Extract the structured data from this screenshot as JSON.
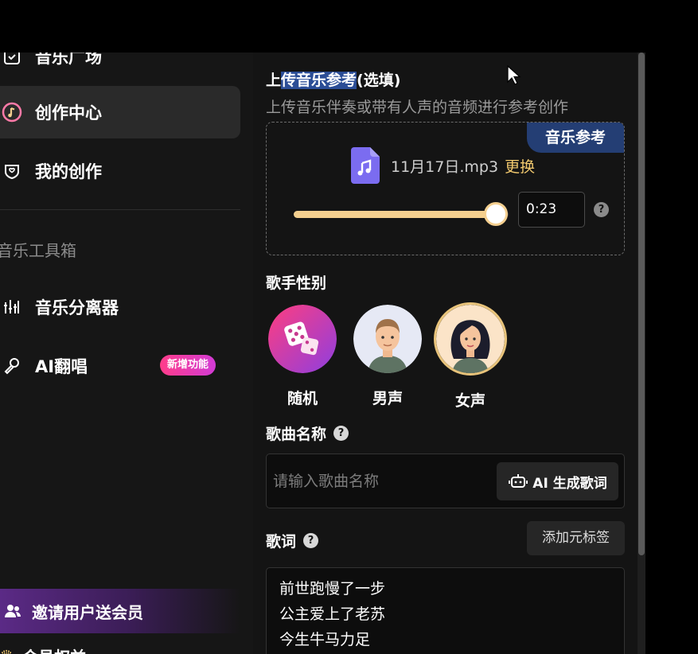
{
  "sidebar": {
    "nav_top": {
      "label": "音乐广场",
      "icon": "calendar-icon"
    },
    "nav_create": {
      "label": "创作中心",
      "icon": "music-note-disc-icon"
    },
    "nav_mine": {
      "label": "我的创作",
      "icon": "shield-heart-icon"
    },
    "toolbox_title": "音乐工具箱",
    "nav_separator": {
      "label": "音乐分离器",
      "icon": "equalizer-icon"
    },
    "nav_cover": {
      "label": "AI翻唱",
      "icon": "microphone-icon",
      "badge": "新增功能"
    },
    "invite": {
      "label": "邀请用户送会员",
      "icon": "users-icon"
    },
    "cut_item": {
      "label": "会员权益"
    }
  },
  "upload": {
    "title_pre": "上",
    "title_selected": "传音乐参考",
    "title_post": "(选填)",
    "description": "上传音乐伴奏或带有人声的音频进行参考创作",
    "ref_tag": "音乐参考",
    "file_name": "11月17日.mp3",
    "replace_label": "更换",
    "time_value": "0:23",
    "slider_fraction": 0.94,
    "help": "?"
  },
  "gender": {
    "title": "歌手性别",
    "options": [
      {
        "label": "随机",
        "icon": "dice-icon"
      },
      {
        "label": "男声",
        "icon": "male-avatar-icon"
      },
      {
        "label": "女声",
        "icon": "female-avatar-icon",
        "selected": true
      }
    ]
  },
  "song": {
    "title": "歌曲名称",
    "help": "?",
    "placeholder": "请输入歌曲名称",
    "ai_button_label": "AI 生成歌词",
    "ai_button_icon": "robot-icon"
  },
  "lyrics": {
    "title": "歌词",
    "help": "?",
    "add_tag_label": "添加元标签",
    "lines": [
      "前世跑慢了一步",
      "公主爱上了老苏",
      "今生牛马力足"
    ]
  },
  "colors": {
    "accent_gold": "#f4cf8f",
    "tag_blue": "#243e74",
    "badge_pink": "#ff3d8a",
    "invite_purple": "#5b2a86"
  }
}
